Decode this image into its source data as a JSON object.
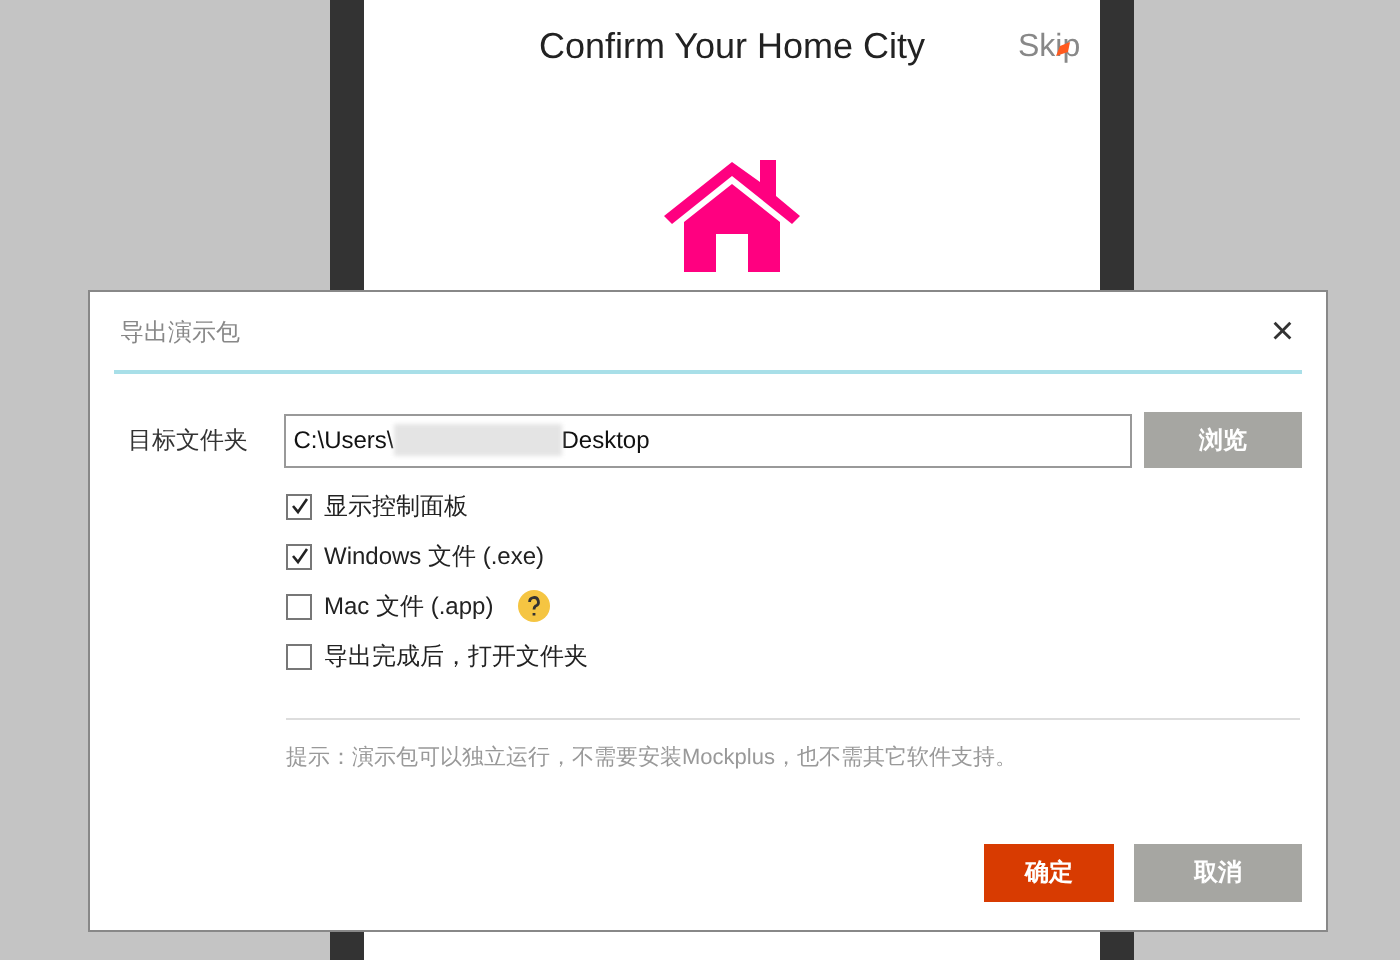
{
  "background_screen": {
    "title": "Confirm Your Home City",
    "skip_link": "Skip"
  },
  "dialog": {
    "title": "导出演示包",
    "close": "×",
    "folder": {
      "label": "目标文件夹",
      "value_start": "C:\\Users\\",
      "value_end": "Desktop",
      "browse": "浏览"
    },
    "options": [
      {
        "label": "显示控制面板",
        "checked": true,
        "help": false
      },
      {
        "label": "Windows 文件 (.exe)",
        "checked": true,
        "help": false
      },
      {
        "label": "Mac 文件 (.app)",
        "checked": false,
        "help": true
      },
      {
        "label": "导出完成后，打开文件夹",
        "checked": false,
        "help": false
      }
    ],
    "hint": "提示：演示包可以独立运行，不需要安装Mockplus，也不需其它软件支持。",
    "buttons": [
      {
        "label": "确定",
        "kind": "primary"
      },
      {
        "label": "取消",
        "kind": "secondary"
      }
    ]
  }
}
